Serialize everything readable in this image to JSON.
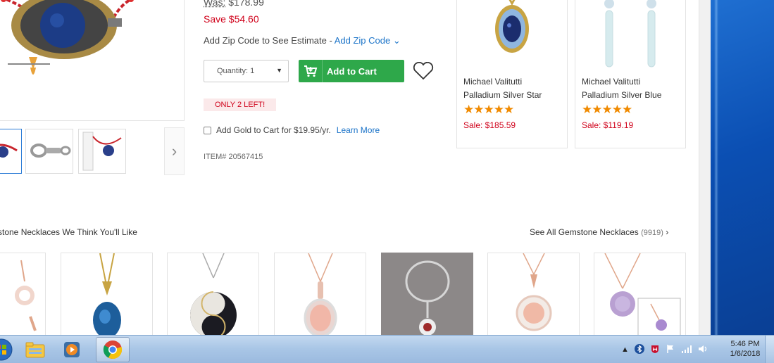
{
  "product": {
    "was_label": "Was:",
    "was_price": "$178.99",
    "save": "Save $54.60",
    "zip_text": "Add Zip Code to See Estimate -",
    "zip_link": "Add Zip Code",
    "quantity": "Quantity: 1",
    "add_to_cart": "Add to Cart",
    "only_left": "ONLY 2 LEFT!",
    "gold_text": "Add Gold to Cart for $19.95/yr.",
    "gold_link": "Learn More",
    "item_number": "ITEM# 20567415"
  },
  "related": [
    {
      "name_line1": "Michael Valitutti",
      "name_line2": "Palladium Silver Star",
      "rating": 5,
      "stars": "★★★★★",
      "sale": "Sale: $185.59"
    },
    {
      "name_line1": "Michael Valitutti",
      "name_line2": "Palladium Silver Blue",
      "rating": 5,
      "stars": "★★★★★",
      "sale": "Sale: $119.19"
    }
  ],
  "recommendations": {
    "title": "stone Necklaces We Think You'll Like",
    "see_all": "See All Gemstone Necklaces",
    "see_all_count": "(9919)",
    "chevron": "›"
  },
  "taskbar": {
    "time": "5:46 PM",
    "date": "1/6/2018",
    "icons": [
      "start-orb-icon",
      "file-explorer-icon",
      "media-player-icon",
      "chrome-icon"
    ]
  },
  "colors": {
    "accent_green": "#2ea84a",
    "sale_red": "#d0021b",
    "link_blue": "#1a73c8",
    "star_orange": "#f08a00"
  }
}
